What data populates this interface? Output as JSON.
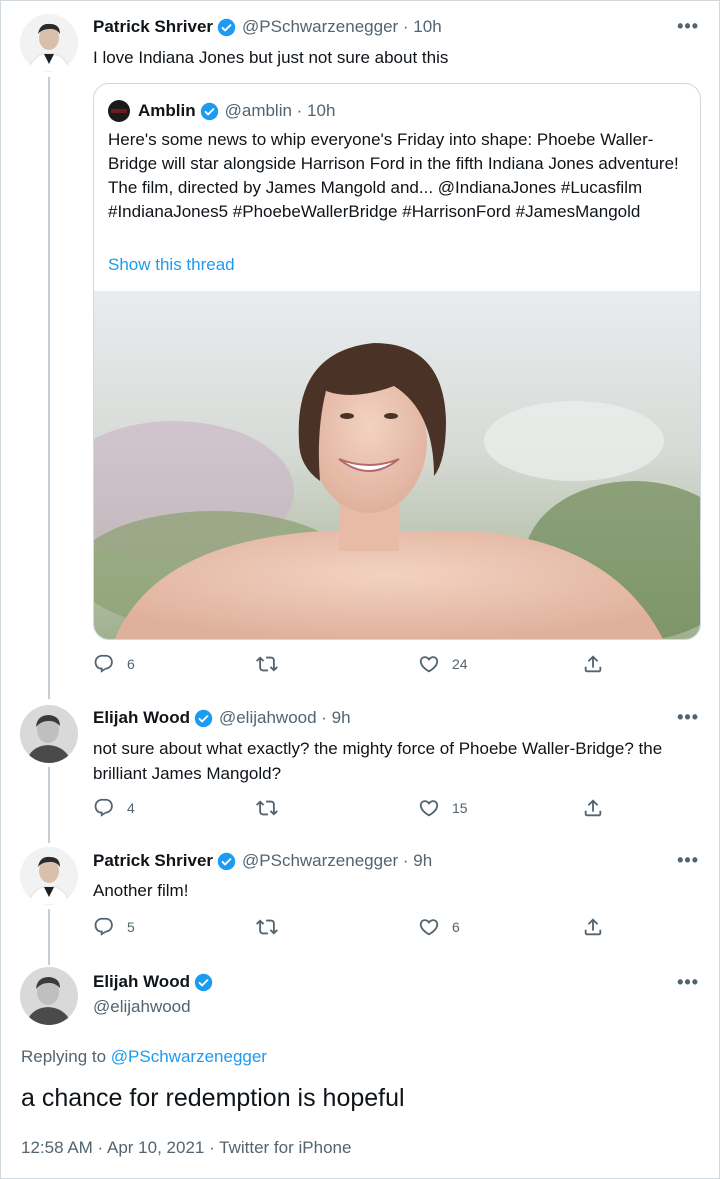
{
  "tweets": [
    {
      "name": "Patrick Shriver",
      "handle": "@PSchwarzenegger · 10h",
      "text": "I love Indiana Jones but just not sure about this",
      "quote": {
        "name": "Amblin",
        "handle": "@amblin · 10h",
        "text": "Here's some news to whip everyone's Friday into shape: Phoebe Waller-Bridge will star alongside Harrison Ford in the fifth Indiana Jones adventure! The film, directed by James Mangold and... @IndianaJones #Lucasfilm #IndianaJones5 #PhoebeWallerBridge #HarrisonFord #JamesMangold",
        "thread_link": "Show this thread"
      },
      "replies": "6",
      "retweets": "",
      "likes": "24"
    },
    {
      "name": "Elijah Wood",
      "handle": "@elijahwood · 9h",
      "text": "not sure about what exactly? the mighty force of Phoebe Waller-Bridge? the brilliant James Mangold?",
      "replies": "4",
      "retweets": "",
      "likes": "15"
    },
    {
      "name": "Patrick Shriver",
      "handle": "@PSchwarzenegger · 9h",
      "text": "Another film!",
      "replies": "5",
      "retweets": "",
      "likes": "6"
    }
  ],
  "focused": {
    "name": "Elijah Wood",
    "handle": "@elijahwood",
    "replying_prefix": "Replying to",
    "replying_to": "@PSchwarzenegger",
    "text": "a chance for redemption is hopeful",
    "meta": "12:58 AM · Apr 10, 2021 · Twitter for iPhone"
  },
  "more_label": "•••",
  "colors": {
    "accent": "#1d9bf0",
    "secondary_text": "#536471",
    "border": "#cfd9de"
  },
  "icons": [
    "verified-badge-icon",
    "reply-icon",
    "retweet-icon",
    "like-icon",
    "share-icon",
    "more-icon"
  ]
}
